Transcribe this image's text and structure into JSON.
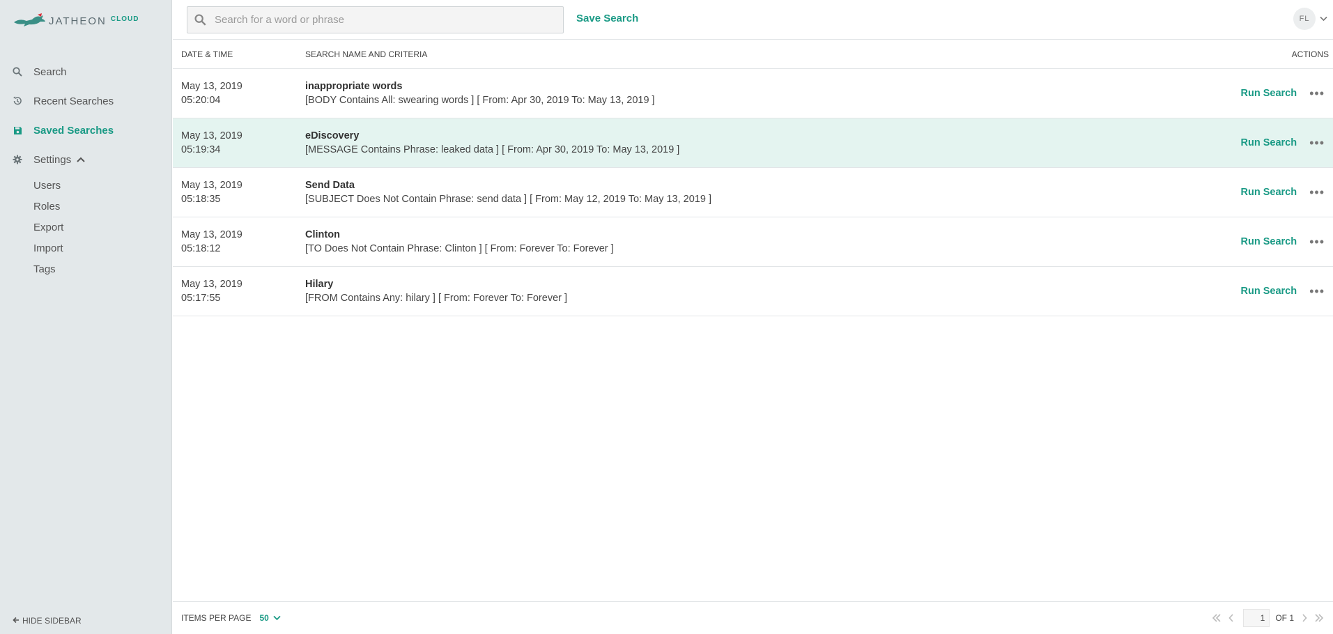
{
  "brand": {
    "name": "JATHEON",
    "suffix": "CLOUD",
    "accent": "#1a9a85",
    "logo_accent": "#d8323c"
  },
  "sidebar": {
    "items": [
      {
        "label": "Search",
        "icon": "search-icon"
      },
      {
        "label": "Recent Searches",
        "icon": "history-icon"
      },
      {
        "label": "Saved Searches",
        "icon": "save-icon",
        "active": true
      },
      {
        "label": "Settings",
        "icon": "gear-icon",
        "expanded": true
      }
    ],
    "settings_subitems": [
      "Users",
      "Roles",
      "Export",
      "Import",
      "Tags"
    ],
    "hide_label": "HIDE SIDEBAR"
  },
  "header": {
    "search_placeholder": "Search for a word or phrase",
    "save_search_label": "Save Search",
    "user_initials": "FL"
  },
  "table": {
    "columns": {
      "date": "DATE & TIME",
      "name": "SEARCH NAME AND CRITERIA",
      "actions": "ACTIONS"
    },
    "run_label": "Run Search",
    "rows": [
      {
        "date": "May 13, 2019",
        "time": "05:20:04",
        "name": "inappropriate words",
        "criteria": "[BODY Contains All: swearing words ] [ From: Apr 30, 2019 To: May 13, 2019 ]"
      },
      {
        "date": "May 13, 2019",
        "time": "05:19:34",
        "name": "eDiscovery",
        "criteria": "[MESSAGE Contains Phrase: leaked data ] [ From: Apr 30, 2019 To: May 13, 2019 ]",
        "highlighted": true
      },
      {
        "date": "May 13, 2019",
        "time": "05:18:35",
        "name": "Send Data",
        "criteria": "[SUBJECT Does Not Contain Phrase: send data ] [ From: May 12, 2019 To: May 13, 2019 ]"
      },
      {
        "date": "May 13, 2019",
        "time": "05:18:12",
        "name": "Clinton",
        "criteria": "[TO Does Not Contain Phrase: Clinton ] [ From: Forever To: Forever ]"
      },
      {
        "date": "May 13, 2019",
        "time": "05:17:55",
        "name": "Hilary",
        "criteria": "[FROM Contains Any: hilary ] [ From: Forever To: Forever ]"
      }
    ]
  },
  "footer": {
    "items_per_page_label": "ITEMS PER PAGE",
    "items_per_page": "50",
    "page": "1",
    "of_label": "OF 1"
  }
}
